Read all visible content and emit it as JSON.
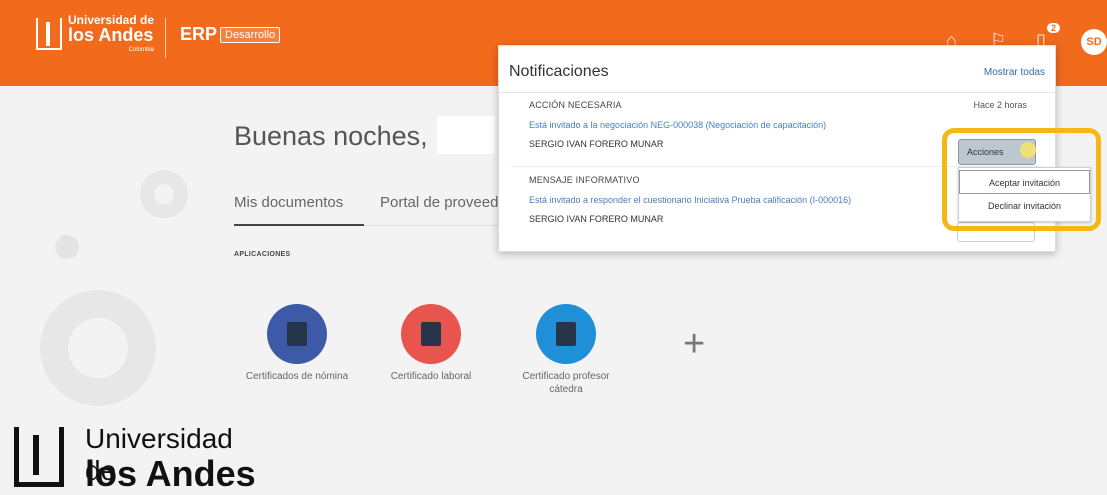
{
  "header": {
    "logo_line1": "Universidad de",
    "logo_line2": "los Andes",
    "logo_line3": "Colombia",
    "app_name": "ERP",
    "env_badge": "Desarrollo",
    "notification_count": "2",
    "avatar_initials": "SD",
    "icons": [
      "home-icon",
      "flag-icon",
      "bell-icon"
    ],
    "bg_color": "#f26b1d"
  },
  "main": {
    "greeting": "Buenas noches,",
    "tabs": [
      {
        "label": "Mis documentos",
        "active": true
      },
      {
        "label": "Portal de proveedo",
        "active": false
      }
    ],
    "apps_title": "APLICACIONES",
    "apps": [
      {
        "label": "Certificados de nómina",
        "color": "#3d5aa8"
      },
      {
        "label": "Certificado laboral",
        "color": "#e8554e"
      },
      {
        "label": "Certificado profesor cátedra",
        "color": "#1f8fd8"
      }
    ],
    "add_symbol": "+"
  },
  "notifications": {
    "title": "Notificaciones",
    "show_all": "Mostrar todas",
    "items": [
      {
        "type": "ACCIÓN NECESARIA",
        "time": "Hace 2 horas",
        "message": "Está invitado a la negociación NEG-000038 (Negociación de capacitación)",
        "from": "SERGIO IVAN FORERO MUNAR"
      },
      {
        "type": "MENSAJE INFORMATIVO",
        "time": "",
        "message": "Está invitado a responder el cuestionario Iniciativa Prueba calificación (I-000016)",
        "from": "SERGIO IVAN FORERO MUNAR"
      }
    ],
    "actions_button": "Acciones",
    "actions_menu": [
      "Aceptar invitación",
      "Declinar invitación"
    ]
  },
  "watermark": {
    "line1": "Universidad de",
    "line2": "los Andes"
  }
}
